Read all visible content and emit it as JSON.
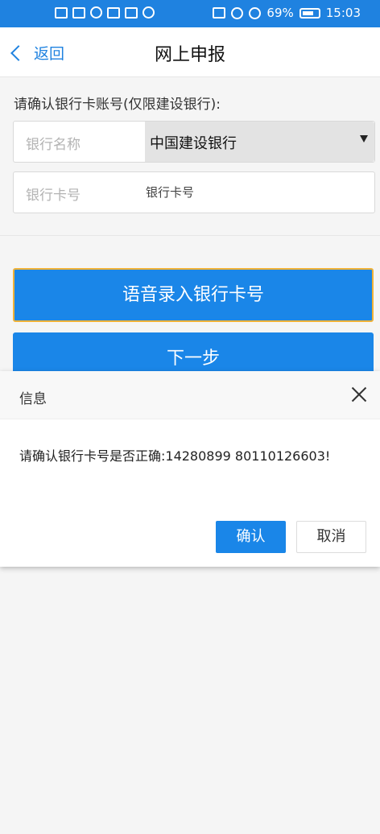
{
  "status_bar": {
    "battery": "69%",
    "time": "15:03",
    "icons": [
      "hd-icon",
      "signal-4g-icon",
      "hotspot-icon",
      "screen-icon",
      "notification-icon",
      "qq-icon",
      "cast-icon",
      "alarm-icon",
      "mute-icon",
      "battery-icon"
    ]
  },
  "header": {
    "back_label": "返回",
    "title": "网上申报"
  },
  "form": {
    "hint": "请确认银行卡账号(仅限建设银行):",
    "bank_label": "银行名称",
    "bank_selected": "中国建设银行",
    "card_label": "银行卡号",
    "card_placeholder": "银行卡号"
  },
  "buttons": {
    "voice": "语音录入银行卡号",
    "next": "下一步"
  },
  "dialog": {
    "title": "信息",
    "message": "请确认银行卡号是否正确:14280899 80110126603!",
    "ok": "确认",
    "cancel": "取消"
  },
  "colors": {
    "brand": "#1a86e8",
    "status_bar": "#1f82e0",
    "focus_border": "#f0b238"
  }
}
